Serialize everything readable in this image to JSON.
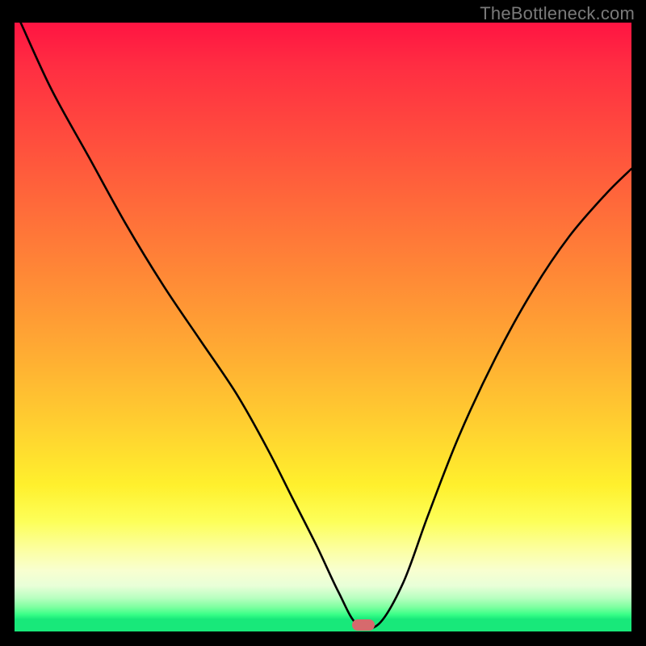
{
  "watermark": "TheBottleneck.com",
  "marker": {
    "x_frac": 0.565,
    "y_frac": 0.99
  },
  "chart_data": {
    "type": "line",
    "title": "",
    "xlabel": "",
    "ylabel": "",
    "xlim": [
      0,
      100
    ],
    "ylim": [
      0,
      100
    ],
    "grid": false,
    "background": "vertical heat gradient (red at top → green at bottom)",
    "series": [
      {
        "name": "bottleneck-curve",
        "x": [
          1,
          6,
          12,
          18,
          24,
          30,
          36,
          41,
          45,
          49,
          52.5,
          55.5,
          59,
          63,
          67,
          72,
          78,
          84,
          90,
          96,
          100
        ],
        "values": [
          100,
          89,
          78,
          67,
          57,
          48,
          39,
          30,
          22,
          14,
          6.5,
          1.2,
          1.2,
          8,
          19,
          32,
          45,
          56,
          65,
          72,
          76
        ]
      }
    ],
    "annotations": [
      {
        "type": "marker",
        "shape": "rounded-pill",
        "color": "#d66a6d",
        "x": 56.5,
        "y": 1.0
      }
    ]
  }
}
